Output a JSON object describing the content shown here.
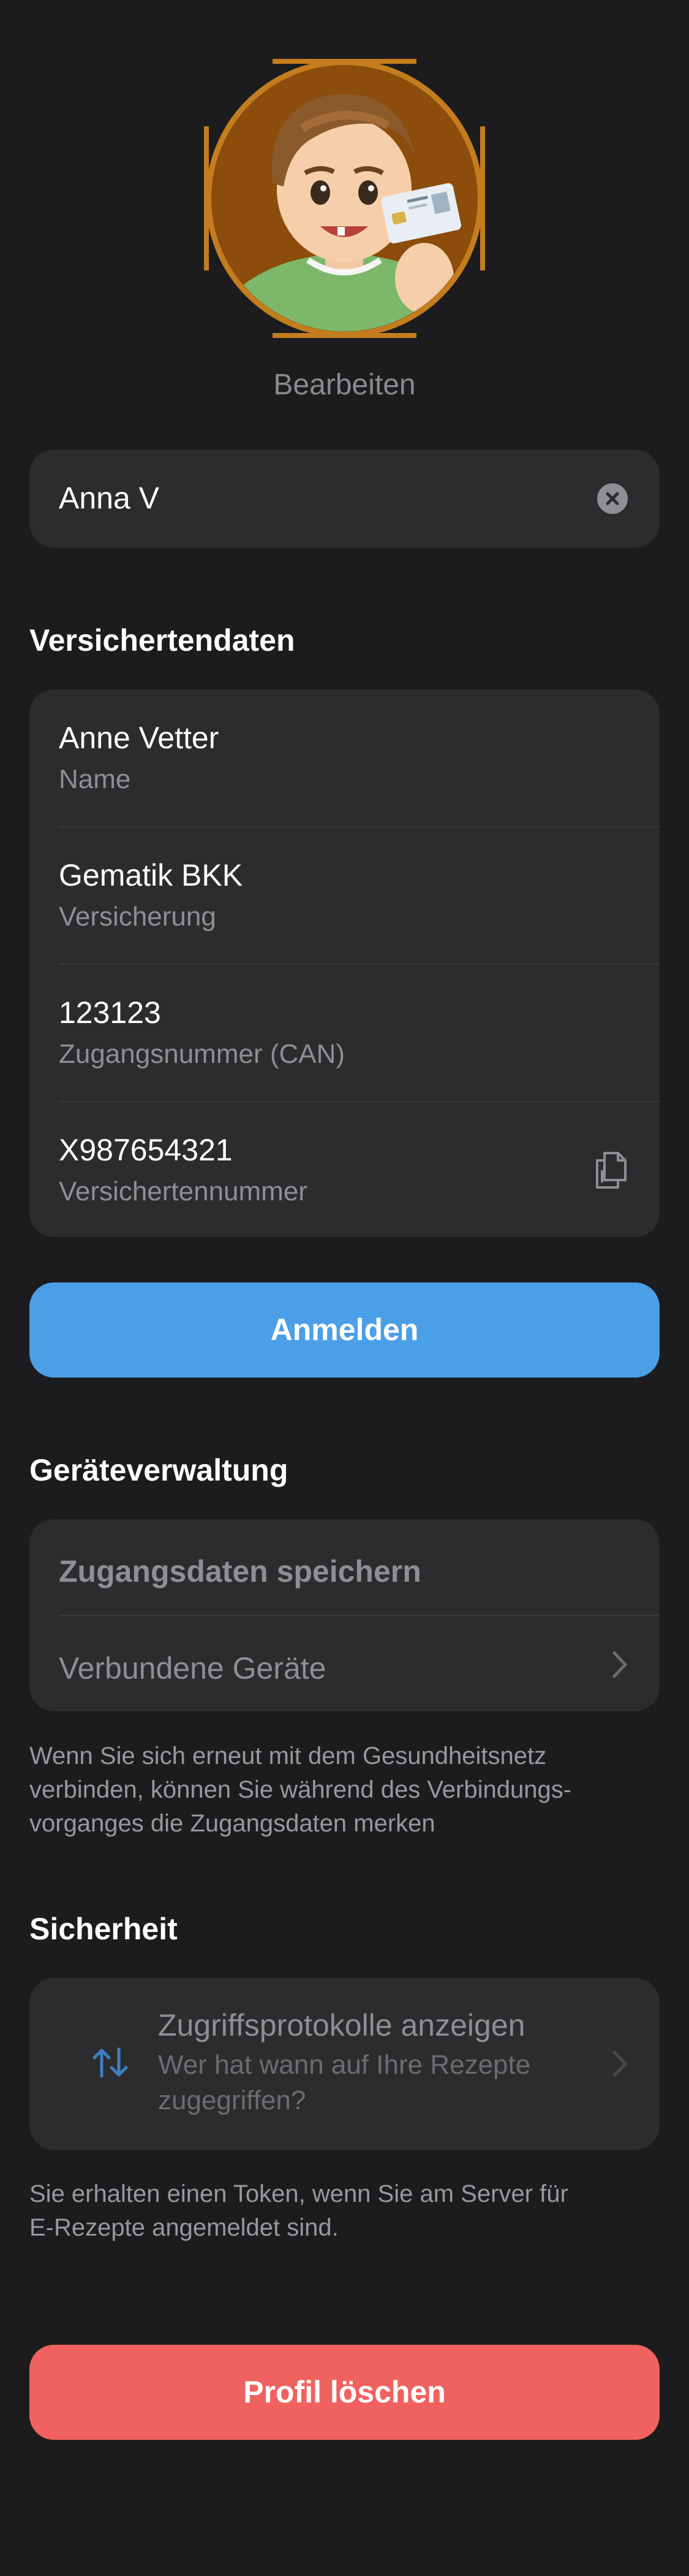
{
  "profile": {
    "edit_label": "Bearbeiten",
    "name_value": "Anna V"
  },
  "insurance": {
    "section_title": "Versichertendaten",
    "rows": [
      {
        "value": "Anne Vetter",
        "label": "Name"
      },
      {
        "value": "Gematik BKK",
        "label": "Versicherung"
      },
      {
        "value": "123123",
        "label": "Zugangsnummer (CAN)"
      },
      {
        "value": "X987654321",
        "label": "Versichertennummer"
      }
    ],
    "login_label": "Anmelden"
  },
  "devices": {
    "section_title": "Geräteverwaltung",
    "save_credentials_label": "Zugangsdaten speichern",
    "connected_devices_label": "Verbundene Geräte",
    "note_lines": [
      "Wenn Sie sich erneut mit dem Gesundheitsnetz",
      "verbinden, können Sie während des Verbindungs-",
      "vorganges die Zugangsdaten merken"
    ]
  },
  "security": {
    "section_title": "Sicherheit",
    "access_log_title": "Zugriffsprotokolle anzeigen",
    "access_log_subtitle": "Wer hat wann auf Ihre Rezepte zugegriffen?",
    "note_lines": [
      "Sie erhalten einen Token, wenn Sie am Server für",
      "E-Rezepte angemeldet sind."
    ]
  },
  "delete_label": "Profil löschen",
  "colors": {
    "background": "#1c1c1e",
    "card": "#2c2c2e",
    "accent_blue": "#4a9fe6",
    "danger_red": "#f0625f",
    "avatar_ring": "#c47d1e"
  },
  "icons": {
    "clear": "clear-circle-icon",
    "copy": "copy-icon",
    "chevron": "chevron-right-icon",
    "access_log": "arrows-up-down-icon"
  }
}
